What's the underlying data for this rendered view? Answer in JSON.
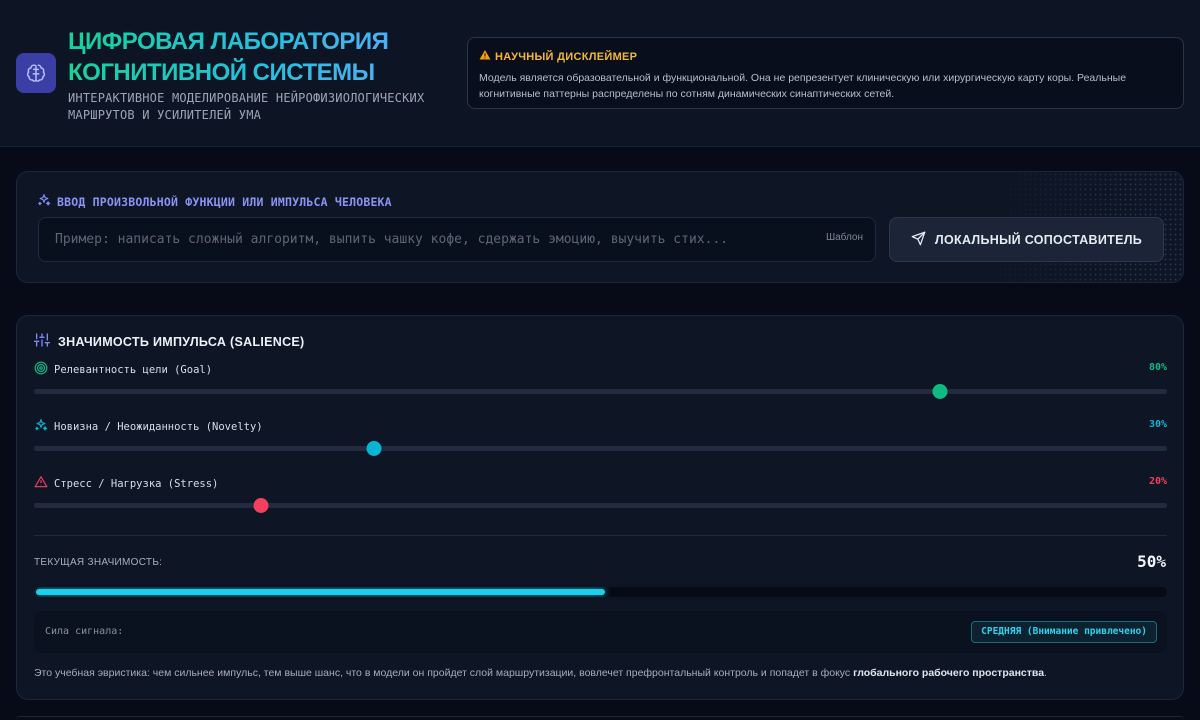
{
  "header": {
    "title": "ЦИФРОВАЯ ЛАБОРАТОРИЯ КОГНИТИВНОЙ СИСТЕМЫ",
    "subtitle": "ИНТЕРАКТИВНОЕ МОДЕЛИРОВАНИЕ НЕЙРОФИЗИОЛОГИЧЕСКИХ МАРШРУТОВ И УСИЛИТЕЛЕЙ УМА",
    "logo_icon": "brain-icon"
  },
  "disclaimer": {
    "icon": "warning-icon",
    "title": "НАУЧНЫЙ ДИСКЛЕЙМЕР",
    "text": "Модель является образовательной и функциональной. Она не репрезентует клиническую или хирургическую карту коры. Реальные когнитивные паттерны распределены по сотням динамических синаптических сетей."
  },
  "input_section": {
    "label": "ВВОД ПРОИЗВОЛЬНОЙ ФУНКЦИИ ИЛИ ИМПУЛЬСА ЧЕЛОВЕКА",
    "placeholder": "Пример: написать сложный алгоритм, выпить чашку кофе, сдержать эмоцию, выучить стих...",
    "value": "",
    "template_label": "Шаблон",
    "submit_label": "ЛОКАЛЬНЫЙ СОПОСТАВИТЕЛЬ"
  },
  "salience": {
    "title": "ЗНАЧИМОСТЬ ИМПУЛЬСА (SALIENCE)",
    "sliders": [
      {
        "label": "Релевантность цели (Goal)",
        "value": 80,
        "display": "80%",
        "color": "#10b981",
        "icon": "target-icon"
      },
      {
        "label": "Новизна / Неожиданность (Novelty)",
        "value": 30,
        "display": "30%",
        "color": "#06b6d4",
        "icon": "sparkles-icon"
      },
      {
        "label": "Стресс / Нагрузка (Stress)",
        "value": 20,
        "display": "20%",
        "color": "#f43f5e",
        "icon": "warning-icon"
      }
    ],
    "current_label": "ТЕКУЩАЯ ЗНАЧИМОСТЬ:",
    "current_value": 50,
    "current_display": "50%",
    "signal_label": "Сила сигнала:",
    "signal_badge": "СРЕДНЯЯ (Внимание привлечено)",
    "footnote_prefix": "Это учебная эвристика: чем сильнее импульс, тем выше шанс, что в модели он пройдет слой маршрутизации, вовлечет префронтальный контроль и попадет в фокус ",
    "footnote_bold": "глобального рабочего пространства",
    "footnote_suffix": "."
  },
  "colors": {
    "accent_indigo": "#818cf8",
    "accent_cyan": "#22d3ee",
    "warning": "#f59e0b"
  }
}
